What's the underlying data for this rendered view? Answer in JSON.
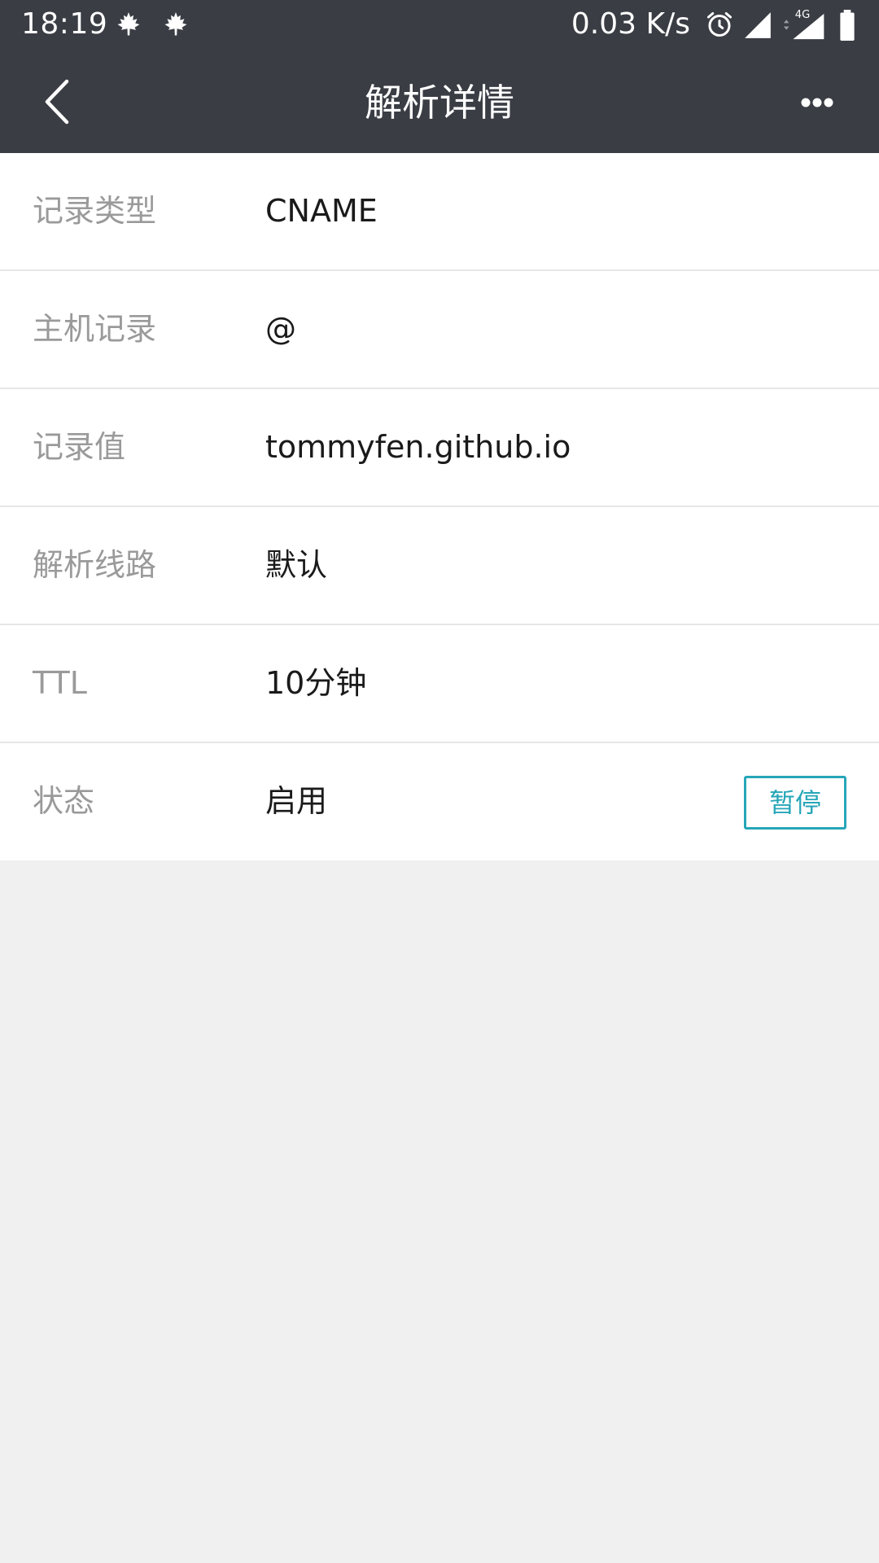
{
  "status_bar": {
    "time": "18:19",
    "net_speed": "0.03 K/s",
    "network_type": "4G",
    "icons": [
      "maple-leaf-icon",
      "maple-leaf-icon",
      "alarm-icon",
      "signal-icon",
      "signal-4g-icon",
      "battery-icon"
    ]
  },
  "app_bar": {
    "title": "解析详情",
    "back_icon": "chevron-left-icon",
    "more_icon": "more-horizontal-icon"
  },
  "details": [
    {
      "label": "记录类型",
      "value": "CNAME"
    },
    {
      "label": "主机记录",
      "value": "@"
    },
    {
      "label": "记录值",
      "value": "tommyfen.github.io"
    },
    {
      "label": "解析线路",
      "value": "默认"
    },
    {
      "label": "TTL",
      "value": "10分钟"
    },
    {
      "label": "状态",
      "value": "启用",
      "action": "暂停"
    }
  ],
  "colors": {
    "app_bar_bg": "#3a3d44",
    "accent": "#26a6b8",
    "page_bg": "#f0f0f0",
    "label_text": "#9a9a9a",
    "value_text": "#1a1a1a"
  }
}
